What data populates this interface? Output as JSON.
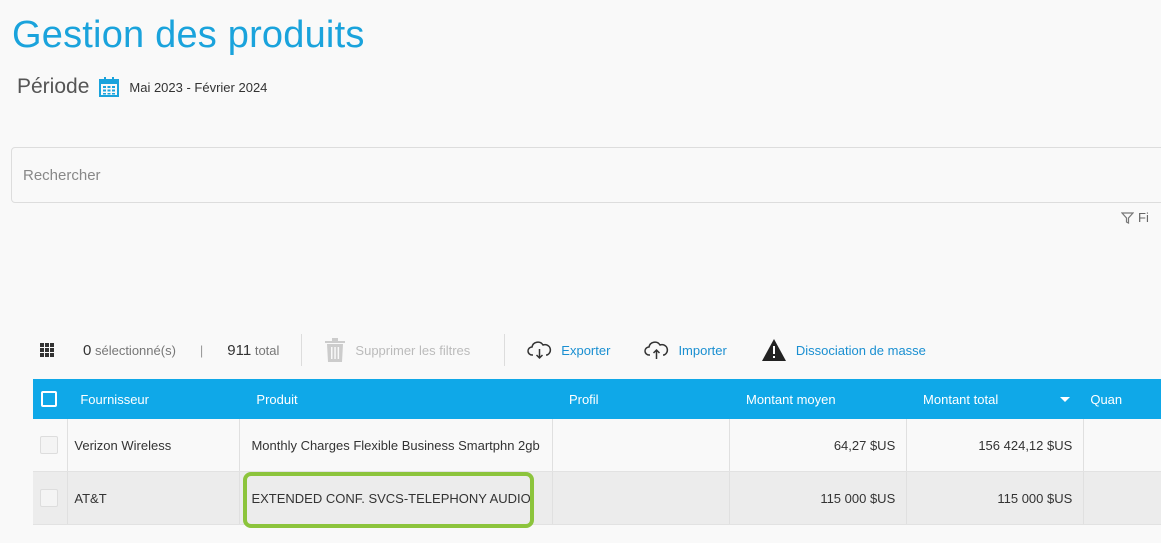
{
  "page": {
    "title": "Gestion des produits",
    "periode_label": "Période",
    "periode_range": "Mai 2023 - Février 2024"
  },
  "search": {
    "placeholder": "Rechercher"
  },
  "filter": {
    "label": "Fi"
  },
  "toolbar": {
    "selected_count": "0",
    "selected_label": "sélectionné(s)",
    "separator": "|",
    "total_count": "911",
    "total_label": "total",
    "clear_filters": "Supprimer les filtres",
    "export": "Exporter",
    "import": "Importer",
    "mass_dissociation": "Dissociation de masse"
  },
  "table": {
    "columns": [
      "Fournisseur",
      "Produit",
      "Profil",
      "Montant moyen",
      "Montant total",
      "Quan"
    ],
    "rows": [
      {
        "fournisseur": "Verizon Wireless",
        "produit": "Monthly Charges Flexible Business Smartphn 2gb",
        "profil": "",
        "montant_moyen": "64,27 $US",
        "montant_total": "156 424,12 $US"
      },
      {
        "fournisseur": "AT&T",
        "produit": "EXTENDED CONF. SVCS-TELEPHONY AUDIO",
        "profil": "",
        "montant_moyen": "115 000 $US",
        "montant_total": "115 000 $US"
      }
    ]
  },
  "colors": {
    "accent": "#1aa3dc",
    "header_bg": "#0fa8e8",
    "highlight": "#8cc43c",
    "link": "#1a8fd1"
  }
}
